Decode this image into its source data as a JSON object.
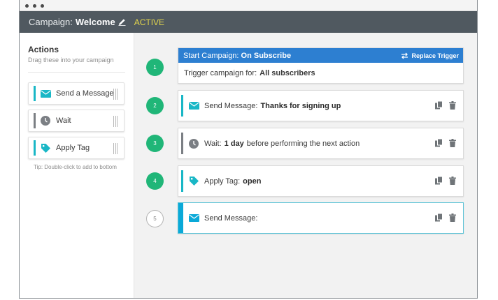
{
  "header": {
    "campaign_label": "Campaign:",
    "campaign_name": "Welcome",
    "status": "ACTIVE"
  },
  "sidebar": {
    "title": "Actions",
    "subtitle": "Drag these into your campaign",
    "items": [
      {
        "label": "Send a Message",
        "icon": "envelope-icon"
      },
      {
        "label": "Wait",
        "icon": "clock-icon"
      },
      {
        "label": "Apply Tag",
        "icon": "tag-icon"
      }
    ],
    "tip": "Tip: Double-click to add to bottom"
  },
  "trigger": {
    "step": "1",
    "head_label": "Start Campaign:",
    "head_value": "On Subscribe",
    "replace_label": "Replace Trigger",
    "body_label": "Trigger campaign for:",
    "body_value": "All subscribers"
  },
  "steps": [
    {
      "num": "2",
      "label": "Send Message:",
      "value": "Thanks for signing up",
      "suffix": ""
    },
    {
      "num": "3",
      "label": "Wait:",
      "value": "1 day",
      "suffix": "before performing the next action"
    },
    {
      "num": "4",
      "label": "Apply Tag:",
      "value": "open",
      "suffix": ""
    },
    {
      "num": "5",
      "label": "Send Message:",
      "value": "",
      "suffix": ""
    }
  ],
  "colors": {
    "header_bg": "#505960",
    "status": "#e3d54d",
    "trigger_blue": "#2d7fd1",
    "step_green": "#20b678",
    "accent_teal": "#19b7c6"
  }
}
